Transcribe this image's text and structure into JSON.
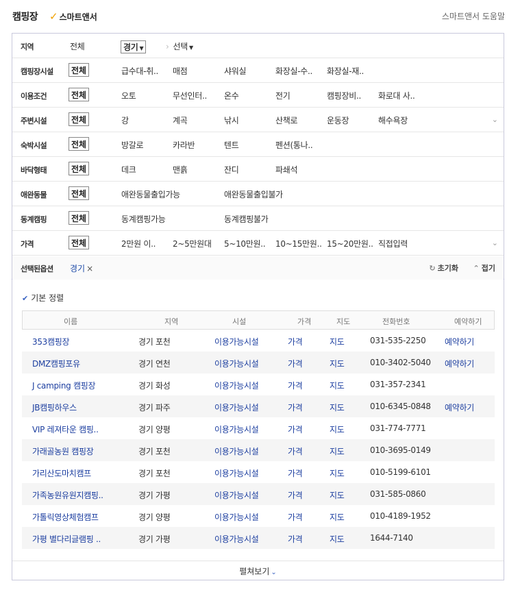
{
  "header": {
    "title": "캠핑장",
    "smart_answer": "스마트앤서",
    "help": "스마트앤서 도움말"
  },
  "filters": {
    "region": {
      "label": "지역",
      "all": "전체",
      "selected": "경기",
      "sub": "선택"
    },
    "rows": [
      {
        "label": "캠핑장시설",
        "all": "전체",
        "options": [
          "급수대-취..",
          "매점",
          "샤워실",
          "화장실-수..",
          "화장실-재.."
        ],
        "toggle": false
      },
      {
        "label": "이용조건",
        "all": "전체",
        "options": [
          "오토",
          "무선인터..",
          "온수",
          "전기",
          "캠핑장비..",
          "화로대 사.."
        ],
        "toggle": false
      },
      {
        "label": "주변시설",
        "all": "전체",
        "options": [
          "강",
          "계곡",
          "낚시",
          "산책로",
          "운동장",
          "해수욕장"
        ],
        "toggle": true
      },
      {
        "label": "숙박시설",
        "all": "전체",
        "options": [
          "방갈로",
          "카라반",
          "텐트",
          "펜션(통나.."
        ],
        "toggle": false
      },
      {
        "label": "바닥형태",
        "all": "전체",
        "options": [
          "데크",
          "맨흙",
          "잔디",
          "파쇄석"
        ],
        "toggle": false
      },
      {
        "label": "애완동물",
        "all": "전체",
        "options": [
          "애완동물출입가능",
          "애완동물출입불가"
        ],
        "wide": true,
        "toggle": false
      },
      {
        "label": "동계캠핑",
        "all": "전체",
        "options": [
          "동계캠핑가능",
          "동계캠핑불가"
        ],
        "wide": true,
        "toggle": false
      },
      {
        "label": "가격",
        "all": "전체",
        "options": [
          "2만원 이..",
          "2~5만원대",
          "5~10만원..",
          "10~15만원..",
          "15~20만원..",
          "직접입력"
        ],
        "toggle": true
      }
    ],
    "selected": {
      "label": "선택된옵션",
      "chip": "경기",
      "reset": "초기화",
      "collapse": "접기"
    }
  },
  "sort": {
    "label": "기본 정렬"
  },
  "table": {
    "headers": [
      "이름",
      "지역",
      "시설",
      "가격",
      "지도",
      "전화번호",
      "예약하기"
    ],
    "rows": [
      {
        "name": "353캠핑장",
        "region": "경기 포천",
        "facility": "이용가능시설",
        "price": "가격",
        "map": "지도",
        "phone": "031-535-2250",
        "reserve": "예약하기"
      },
      {
        "name": "DMZ캠핑포유",
        "region": "경기 연천",
        "facility": "이용가능시설",
        "price": "가격",
        "map": "지도",
        "phone": "010-3402-5040",
        "reserve": "예약하기"
      },
      {
        "name": "J camping 캠핑장",
        "region": "경기 화성",
        "facility": "이용가능시설",
        "price": "가격",
        "map": "지도",
        "phone": "031-357-2341",
        "reserve": ""
      },
      {
        "name": "JB캠핑하우스",
        "region": "경기 파주",
        "facility": "이용가능시설",
        "price": "가격",
        "map": "지도",
        "phone": "010-6345-0848",
        "reserve": "예약하기"
      },
      {
        "name": "VIP 레져타운 캠핑..",
        "region": "경기 양평",
        "facility": "이용가능시설",
        "price": "가격",
        "map": "지도",
        "phone": "031-774-7771",
        "reserve": ""
      },
      {
        "name": "가래골농원 캠핑장",
        "region": "경기 포천",
        "facility": "이용가능시설",
        "price": "가격",
        "map": "지도",
        "phone": "010-3695-0149",
        "reserve": ""
      },
      {
        "name": "가리산도마치캠프",
        "region": "경기 포천",
        "facility": "이용가능시설",
        "price": "가격",
        "map": "지도",
        "phone": "010-5199-6101",
        "reserve": ""
      },
      {
        "name": "가족농원유원지캠핑..",
        "region": "경기 가평",
        "facility": "이용가능시설",
        "price": "가격",
        "map": "지도",
        "phone": "031-585-0860",
        "reserve": ""
      },
      {
        "name": "가톨릭영상체험캠프",
        "region": "경기 양평",
        "facility": "이용가능시설",
        "price": "가격",
        "map": "지도",
        "phone": "010-4189-1952",
        "reserve": ""
      },
      {
        "name": "가평 별다리글램핑 ..",
        "region": "경기 가평",
        "facility": "이용가능시설",
        "price": "가격",
        "map": "지도",
        "phone": "1644-7140",
        "reserve": ""
      }
    ]
  },
  "footer": {
    "expand": "펼쳐보기"
  },
  "colors": {
    "link": "#1d3fa0",
    "accent": "#f0a000",
    "border": "#c9c9dc"
  }
}
